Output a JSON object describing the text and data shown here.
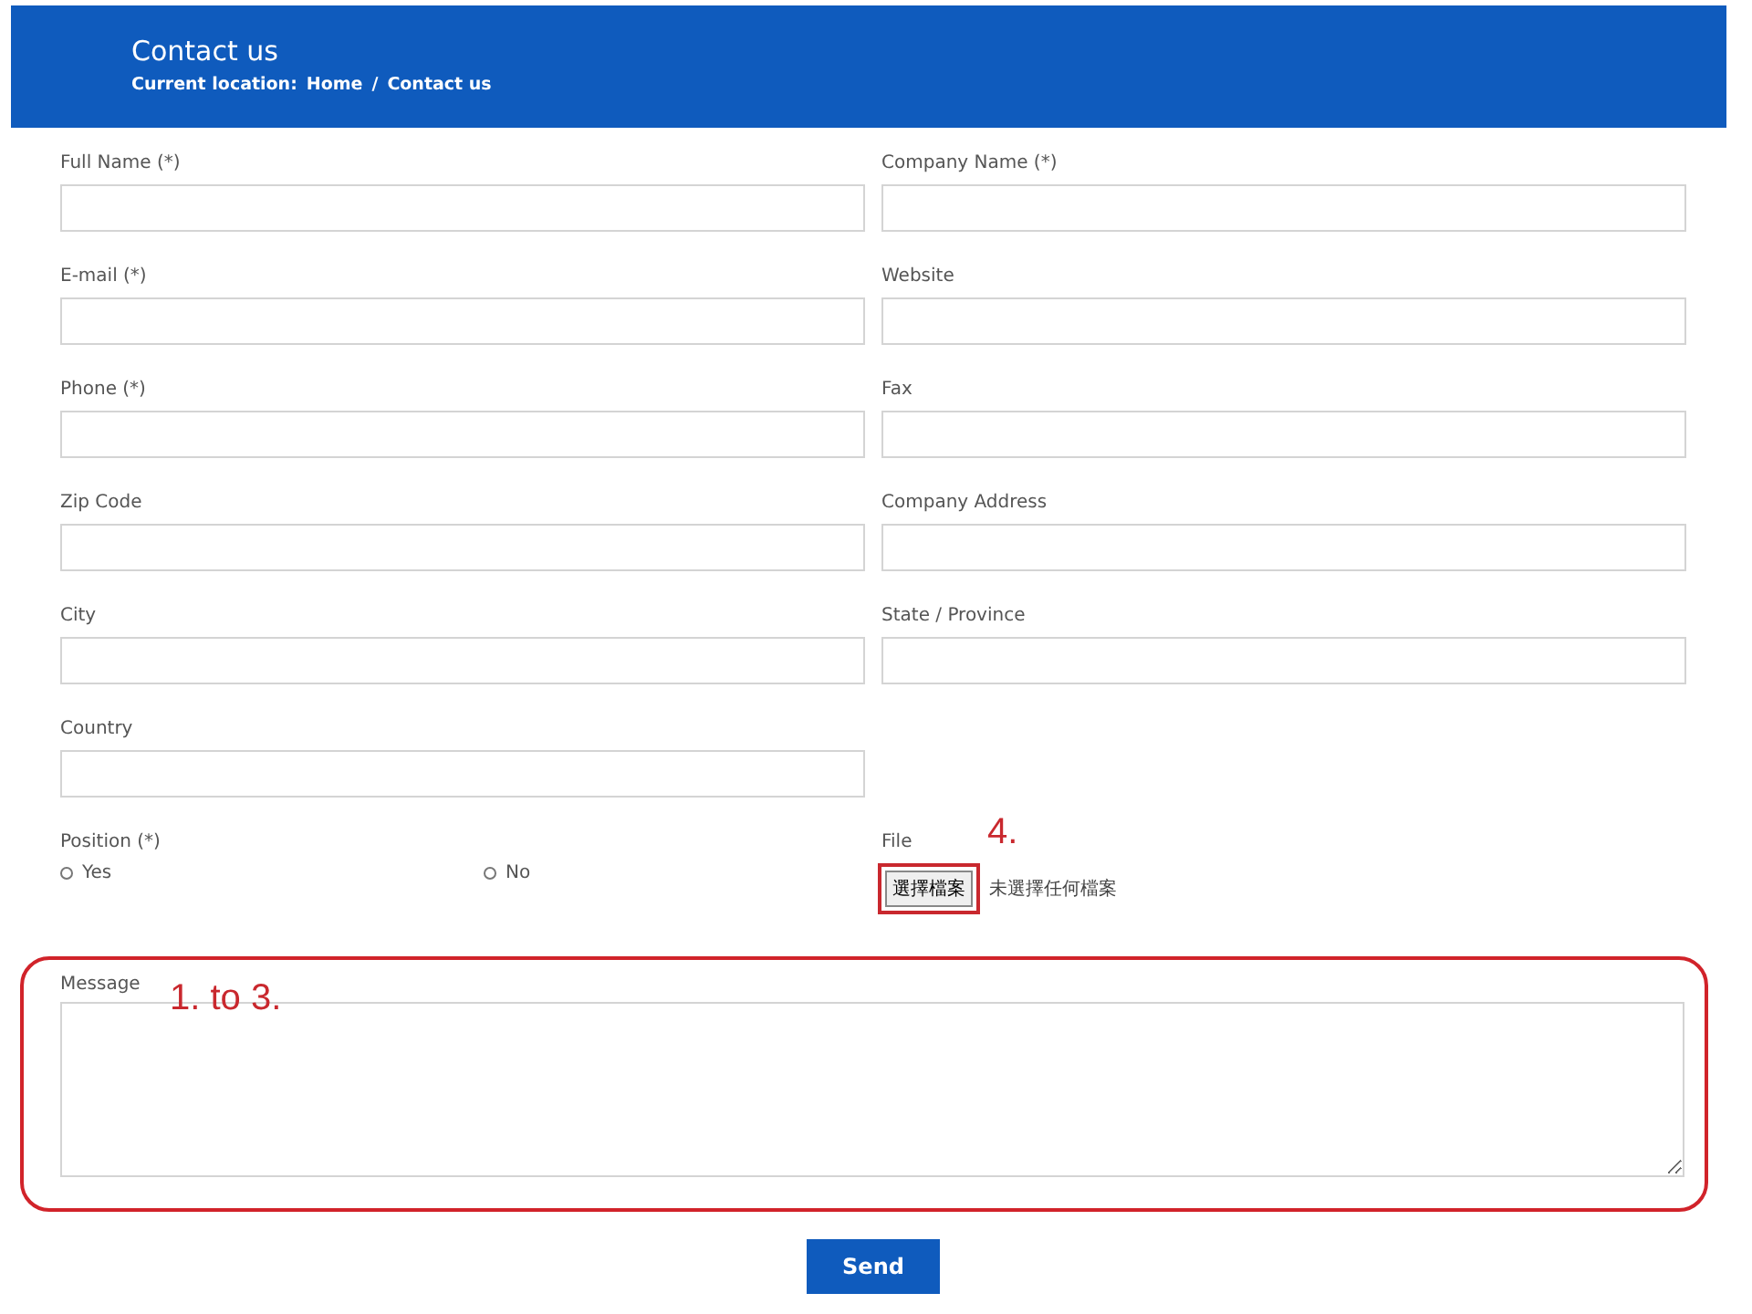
{
  "header": {
    "title": "Contact us",
    "breadcrumb_label": "Current location:",
    "breadcrumb": [
      "Home",
      "Contact us"
    ],
    "separator": "/"
  },
  "rows": [
    [
      {
        "kind": "text",
        "label": "Full Name (*)"
      },
      {
        "kind": "text",
        "label": "Company Name (*)"
      }
    ],
    [
      {
        "kind": "text",
        "label": "E-mail (*)"
      },
      {
        "kind": "text",
        "label": "Website"
      }
    ],
    [
      {
        "kind": "text",
        "label": "Phone (*)"
      },
      {
        "kind": "text",
        "label": "Fax"
      }
    ],
    [
      {
        "kind": "text",
        "label": "Zip Code"
      },
      {
        "kind": "text",
        "label": "Company Address"
      }
    ],
    [
      {
        "kind": "text",
        "label": "City"
      },
      {
        "kind": "text",
        "label": "State / Province"
      }
    ],
    [
      {
        "kind": "text",
        "label": "Country"
      }
    ],
    [
      {
        "kind": "radio",
        "label": "Position (*)",
        "options": [
          {
            "label": "Yes",
            "selected": false
          },
          {
            "label": "No",
            "selected": false
          }
        ]
      },
      {
        "kind": "file",
        "label": "File",
        "button": "選擇檔案",
        "status": "未選擇任何檔案",
        "annotation": "4."
      }
    ]
  ],
  "message": {
    "label": "Message",
    "annotation": "1. to 3."
  },
  "send": "Send"
}
